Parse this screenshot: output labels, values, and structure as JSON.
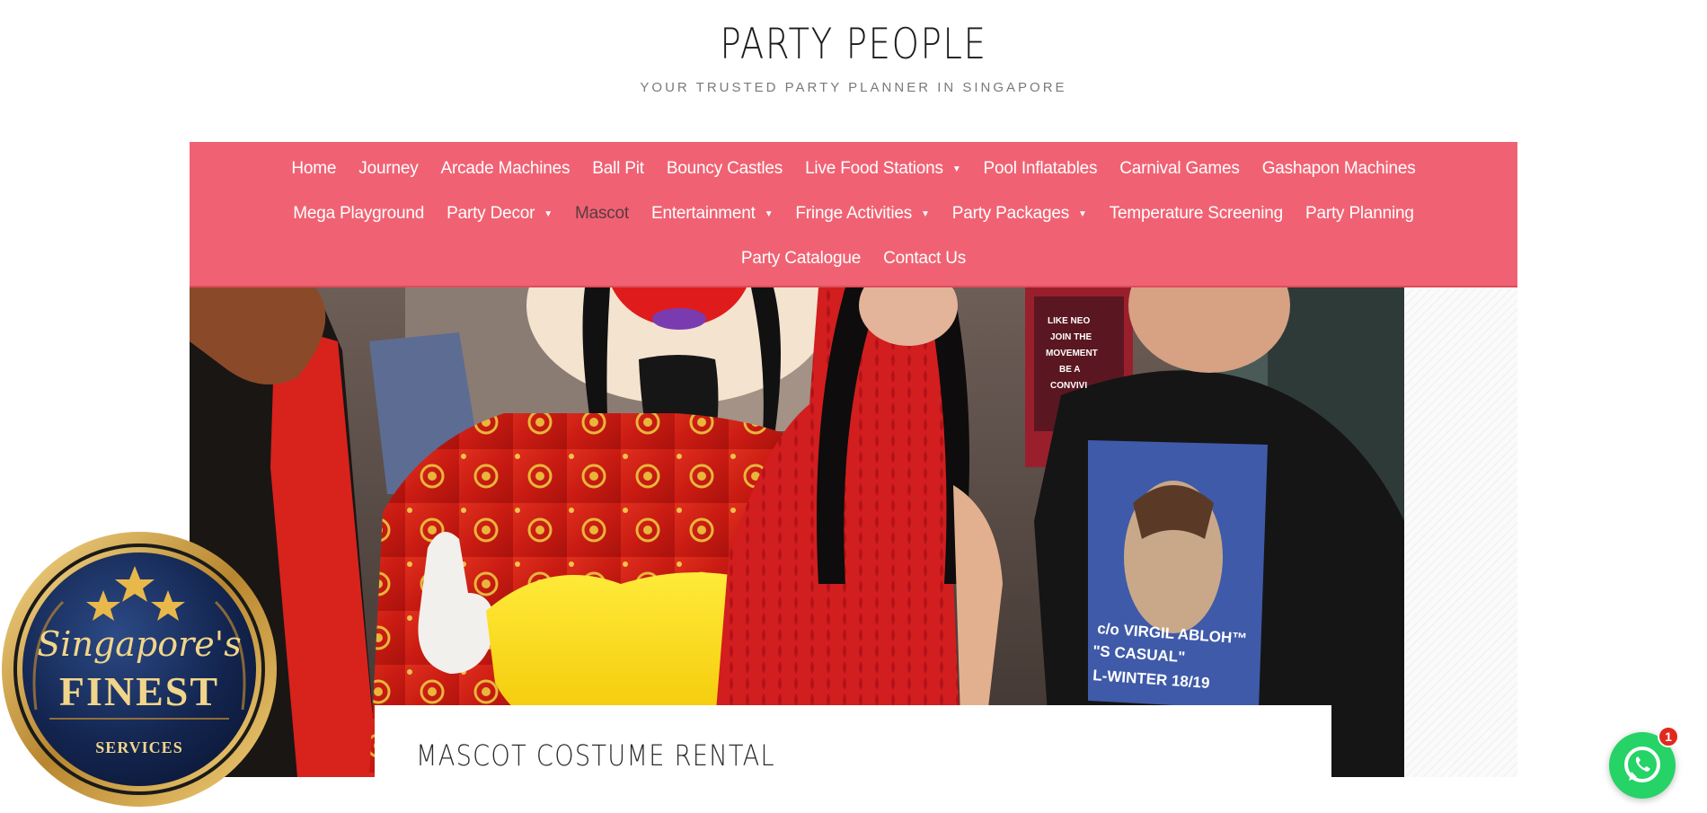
{
  "site": {
    "title": "PARTY PEOPLE",
    "tagline": "YOUR TRUSTED PARTY PLANNER IN SINGAPORE"
  },
  "nav": {
    "row1": [
      "Home",
      "Journey",
      "Arcade Machines",
      "Ball Pit",
      "Bouncy Castles",
      "Live Food Stations",
      "Pool Inflatables",
      "Carnival Games",
      "Gashapon Machines"
    ],
    "row2": [
      "Mega Playground",
      "Party Decor",
      "Mascot",
      "Entertainment",
      "Fringe Activities",
      "Party Packages",
      "Temperature Screening",
      "Party Planning"
    ],
    "row3": [
      "Party Catalogue",
      "Contact Us"
    ],
    "current": "Mascot"
  },
  "hero": {
    "shirt_text": [
      "c/o VIRGIL ABLOH™",
      "\"S CASUAL\"",
      "L-WINTER 18/19"
    ],
    "poster_text": [
      "LIKE NEO",
      "JOIN THE",
      "MOVEMENT",
      "BE A",
      "CONVIVI"
    ]
  },
  "post": {
    "title": "MASCOT COSTUME RENTAL"
  },
  "badge": {
    "line1": "Singapore's",
    "line2": "FINEST",
    "line3": "SERVICES"
  },
  "whatsapp": {
    "count": "1"
  },
  "colors": {
    "nav_bg": "#f06273",
    "badge_navy": "#0f1f44",
    "badge_gold": "#c9a24a",
    "whatsapp": "#25d366"
  }
}
